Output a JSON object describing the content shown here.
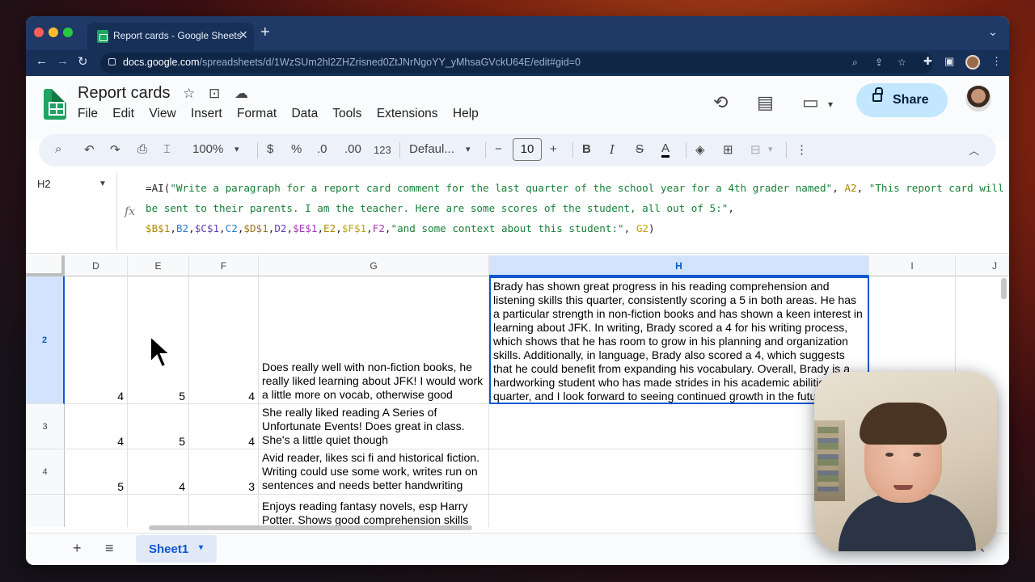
{
  "browser": {
    "tab_title": "Report cards - Google Sheets",
    "tab_close": "✕",
    "new_tab": "+",
    "tab_menu": "⌄",
    "url_host": "docs.google.com",
    "url_path": "/spreadsheets/d/1WzSUm2hl2ZHZrisned0ZtJNrNgoYY_yMhsaGVckU64E/edit#gid=0",
    "nav_back": "←",
    "nav_forward": "→",
    "nav_reload": "↻"
  },
  "app": {
    "title": "Report cards",
    "menus": [
      "File",
      "Edit",
      "View",
      "Insert",
      "Format",
      "Data",
      "Tools",
      "Extensions",
      "Help"
    ],
    "share_label": "Share"
  },
  "toolbar": {
    "zoom": "100%",
    "currency": "$",
    "percent": "%",
    "dec_decrease": ".0",
    "dec_increase": ".00",
    "number_format": "123",
    "font": "Defaul...",
    "font_size": "10",
    "minus": "−",
    "plus": "+",
    "bold": "B",
    "italic": "I",
    "strike": "S",
    "text_color": "A"
  },
  "formula_bar": {
    "name_box": "H2",
    "fx": "fx",
    "line1_a": "=AI(",
    "line1_b": "\"Write a paragraph for a report card comment for the last quarter of the school year for a 4th grader named\"",
    "line1_c": ", ",
    "line1_d": "A2",
    "line1_e": ", ",
    "line1_f": "\"This report card will",
    "line2_a": "be sent to their parents. I am the teacher. Here are some scores of the student, all out of 5:\"",
    "line2_b": ",",
    "line3": [
      {
        "t": "$B$1",
        "c": "ref1"
      },
      {
        "t": ",",
        "c": ""
      },
      {
        "t": "B2",
        "c": "ref2"
      },
      {
        "t": ",",
        "c": ""
      },
      {
        "t": "$C$1",
        "c": "ref3"
      },
      {
        "t": ",",
        "c": ""
      },
      {
        "t": "C2",
        "c": "ref2"
      },
      {
        "t": ",",
        "c": ""
      },
      {
        "t": "$D$1",
        "c": "ref5"
      },
      {
        "t": ",",
        "c": ""
      },
      {
        "t": "D2",
        "c": "ref3"
      },
      {
        "t": ",",
        "c": ""
      },
      {
        "t": "$E$1",
        "c": "ref4"
      },
      {
        "t": ",",
        "c": ""
      },
      {
        "t": "E2",
        "c": "ref1"
      },
      {
        "t": ",",
        "c": ""
      },
      {
        "t": "$F$1",
        "c": "ref6"
      },
      {
        "t": ",",
        "c": ""
      },
      {
        "t": "F2",
        "c": "ref4"
      },
      {
        "t": ",",
        "c": ""
      },
      {
        "t": "\"and some context about this student:\"",
        "c": "fs"
      },
      {
        "t": ", ",
        "c": ""
      },
      {
        "t": "G2",
        "c": "ref6"
      },
      {
        "t": ")",
        "c": ""
      }
    ]
  },
  "grid": {
    "columns": [
      "D",
      "E",
      "F",
      "G",
      "H",
      "I",
      "J"
    ],
    "selected_column": "H",
    "rows": [
      {
        "num": "2",
        "selected": true,
        "D": "4",
        "E": "5",
        "F": "4",
        "G": "Does really well with non-fiction books, he really liked learning about JFK! I would work a little more on vocab, otherwise good",
        "H": "Brady has shown great progress in his reading comprehension and listening skills this quarter, consistently scoring a 5 in both areas. He has a particular strength in non-fiction books and has shown a keen interest in learning about JFK. In writing, Brady scored a 4 for his writing process, which shows that he has room to grow in his planning and organization skills. Additionally, in language, Brady also scored a 4, which suggests that he could benefit from expanding his vocabulary. Overall, Brady is a hardworking student who has made strides in his academic abilities this quarter, and I look forward to seeing continued growth in the future."
      },
      {
        "num": "3",
        "selected": false,
        "D": "4",
        "E": "5",
        "F": "4",
        "G": "She really liked reading A Series of Unfortunate Events! Does great in class. She's a little quiet though",
        "H": ""
      },
      {
        "num": "4",
        "selected": false,
        "D": "5",
        "E": "4",
        "F": "3",
        "G": "Avid reader, likes sci fi and historical fiction. Writing could use some work, writes run on sentences and needs better handwriting",
        "H": ""
      },
      {
        "num": "",
        "selected": false,
        "D": "",
        "E": "",
        "F": "",
        "G": "Enjoys reading fantasy novels, esp Harry Potter. Shows good comprehension skills",
        "H": ""
      }
    ]
  },
  "bottom": {
    "add_sheet": "+",
    "all_sheets": "≡",
    "sheet_name": "Sheet1",
    "sheet_caret": "▾",
    "collapse": "‹"
  },
  "colors": {
    "accent": "#0b57d0",
    "selected_bg": "#d3e3fd",
    "share_bg": "#c2e7ff",
    "sheets_green": "#1ea362",
    "browser_chrome": "#1f3a66"
  }
}
